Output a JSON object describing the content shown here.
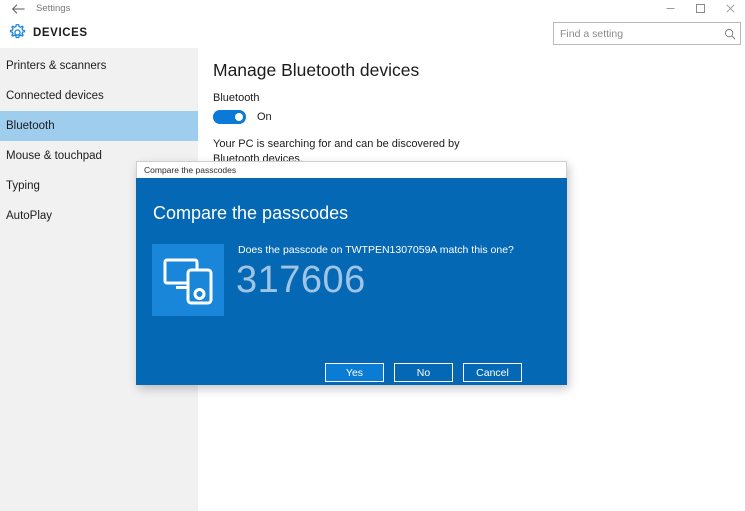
{
  "window": {
    "title": "Settings",
    "back_icon": "back-arrow-icon",
    "minimize_label": "–",
    "maximize_label": "□",
    "close_label": "✕"
  },
  "header": {
    "gear_icon": "gear-icon",
    "app_title": "DEVICES",
    "accent_color": "#0a79d7"
  },
  "search": {
    "placeholder": "Find a setting",
    "value": "",
    "icon": "search-icon"
  },
  "sidebar": {
    "background_color": "#f1f1f1",
    "selected_color": "#9fcdee",
    "items": [
      {
        "label": "Printers & scanners",
        "selected": false
      },
      {
        "label": "Connected devices",
        "selected": false
      },
      {
        "label": "Bluetooth",
        "selected": true
      },
      {
        "label": "Mouse & touchpad",
        "selected": false
      },
      {
        "label": "Typing",
        "selected": false
      },
      {
        "label": "AutoPlay",
        "selected": false
      }
    ]
  },
  "main": {
    "page_title": "Manage Bluetooth devices",
    "bluetooth_label": "Bluetooth",
    "toggle_state": "On",
    "toggle_on": true,
    "description": "Your PC is searching for and can be discovered by Bluetooth devices."
  },
  "dialog": {
    "titlebar_text": "Compare the passcodes",
    "heading": "Compare the passcodes",
    "question": "Does the passcode on TWTPEN1307059A match this one?",
    "device_name": "TWTPEN1307059A",
    "passcode": "317606",
    "icon": "monitor-and-phone-icon",
    "background_color": "#0568b4",
    "icon_tile_color": "#1a86d9",
    "passcode_color": "#9fc4e4",
    "buttons": [
      {
        "label": "Yes",
        "primary": true
      },
      {
        "label": "No",
        "primary": false
      },
      {
        "label": "Cancel",
        "primary": false
      }
    ]
  }
}
